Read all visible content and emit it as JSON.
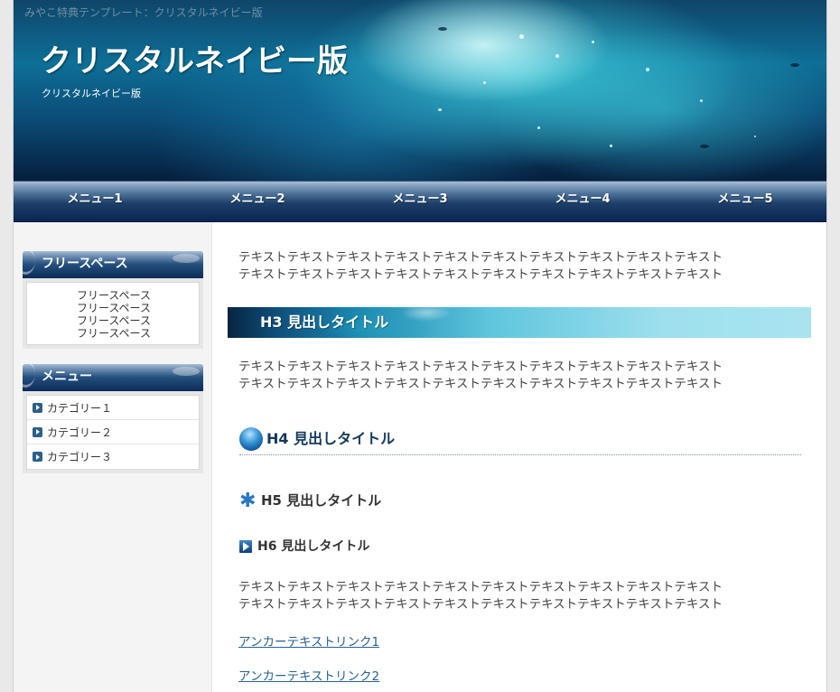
{
  "header": {
    "tagline": "みやこ特典テンプレート：クリスタルネイビー版",
    "title": "クリスタルネイビー版",
    "description": "クリスタルネイビー版"
  },
  "nav": {
    "items": [
      "メニュー1",
      "メニュー2",
      "メニュー3",
      "メニュー4",
      "メニュー5"
    ]
  },
  "sidebar": {
    "free_space": {
      "title": "フリースペース",
      "lines": [
        "フリースペース",
        "フリースペース",
        "フリースペース",
        "フリースペース"
      ]
    },
    "menu": {
      "title": "メニュー",
      "categories": [
        "カテゴリー１",
        "カテゴリー２",
        "カテゴリー３"
      ]
    }
  },
  "main": {
    "paragraph1": [
      "テキストテキストテキストテキストテキストテキストテキストテキストテキストテキスト",
      "テキストテキストテキストテキストテキストテキストテキストテキストテキストテキスト"
    ],
    "h3": "H3 見出しタイトル",
    "paragraph2": [
      "テキストテキストテキストテキストテキストテキストテキストテキストテキストテキスト",
      "テキストテキストテキストテキストテキストテキストテキストテキストテキストテキスト"
    ],
    "h4": "H4 見出しタイトル",
    "h5": "H5 見出しタイトル",
    "h6": "H6 見出しタイトル",
    "paragraph3": [
      "テキストテキストテキストテキストテキストテキストテキストテキストテキストテキスト",
      "テキストテキストテキストテキストテキストテキストテキストテキストテキストテキスト"
    ],
    "links": [
      "アンカーテキストリンク1",
      "アンカーテキストリンク2"
    ]
  },
  "icons": {
    "h4": "sphere-icon",
    "h5": "snowflake-icon",
    "h6": "arrow-right-icon",
    "category": "bullet-arrow-icon"
  },
  "colors": {
    "navy": "#0a2551",
    "accent": "#27628f",
    "heading_text": "#14395e"
  }
}
